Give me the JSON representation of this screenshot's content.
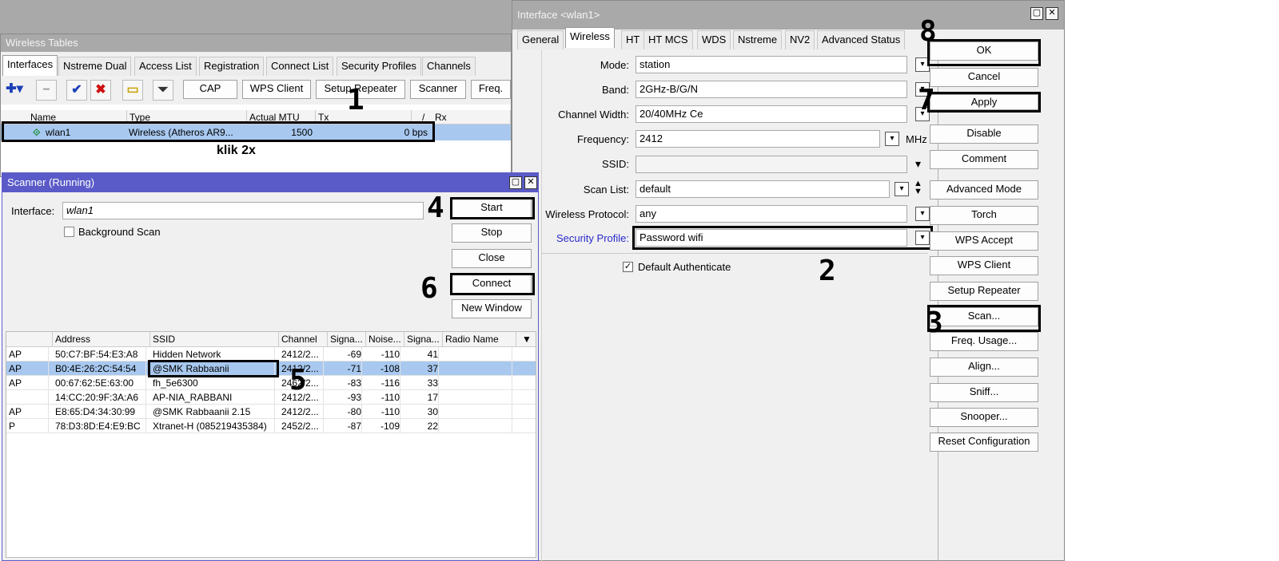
{
  "wireless_tables": {
    "title": "Wireless Tables",
    "tabs": [
      "Interfaces",
      "Nstreme Dual",
      "Access List",
      "Registration",
      "Connect List",
      "Security Profiles",
      "Channels"
    ],
    "toolbar": {
      "cap": "CAP",
      "wps_client": "WPS Client",
      "setup_repeater": "Setup Repeater",
      "scanner": "Scanner",
      "freq": "Freq."
    },
    "columns": [
      "Name",
      "Type",
      "Actual MTU",
      "Tx",
      "/",
      "Rx"
    ],
    "row": {
      "name": "wlan1",
      "type": "Wireless (Atheros AR9...",
      "mtu": "1500",
      "tx": "0 bps"
    },
    "note": "klik 2x"
  },
  "scanner": {
    "title": "Scanner (Running)",
    "interface_label": "Interface:",
    "interface_value": "wlan1",
    "background_scan": "Background Scan",
    "buttons": {
      "start": "Start",
      "stop": "Stop",
      "close": "Close",
      "connect": "Connect",
      "new_window": "New Window"
    },
    "columns": [
      "",
      "Address",
      "SSID",
      "Channel",
      "Signa...",
      "Noise...",
      "Signa...",
      "Radio Name"
    ],
    "rows": [
      [
        "AP",
        "50:C7:BF:54:E3:A8",
        "Hidden Network",
        "2412/2...",
        "-69",
        "-110",
        "41",
        ""
      ],
      [
        "AP",
        "B0:4E:26:2C:54:54",
        "@SMK Rabbaanii",
        "2412/2...",
        "-71",
        "-108",
        "37",
        ""
      ],
      [
        "AP",
        "00:67:62:5E:63:00",
        "fh_5e6300",
        "2462/2...",
        "-83",
        "-116",
        "33",
        ""
      ],
      [
        "",
        "14:CC:20:9F:3A:A6",
        "AP-NIA_RABBANI",
        "2412/2...",
        "-93",
        "-110",
        "17",
        ""
      ],
      [
        "AP",
        "E8:65:D4:34:30:99",
        "@SMK Rabbaanii 2.15",
        "2412/2...",
        "-80",
        "-110",
        "30",
        ""
      ],
      [
        "P",
        "78:D3:8D:E4:E9:BC",
        "Xtranet-H (085219435384)",
        "2452/2...",
        "-87",
        "-109",
        "22",
        ""
      ]
    ]
  },
  "interface": {
    "title": "Interface <wlan1>",
    "tabs": [
      "General",
      "Wireless",
      "HT",
      "HT MCS",
      "WDS",
      "Nstreme",
      "NV2",
      "Advanced Status"
    ],
    "fields": {
      "mode_label": "Mode:",
      "mode": "station",
      "band_label": "Band:",
      "band": "2GHz-B/G/N",
      "cw_label": "Channel Width:",
      "cw": "20/40MHz Ce",
      "freq_label": "Frequency:",
      "freq": "2412",
      "freq_unit": "MHz",
      "ssid_label": "SSID:",
      "ssid": "",
      "scanlist_label": "Scan List:",
      "scanlist": "default",
      "proto_label": "Wireless Protocol:",
      "proto": "any",
      "secprof_label": "Security Profile:",
      "secprof": "Password wifi",
      "default_auth": "Default Authenticate"
    },
    "buttons": [
      "OK",
      "Cancel",
      "Apply",
      "Disable",
      "Comment",
      "Advanced Mode",
      "Torch",
      "WPS Accept",
      "WPS Client",
      "Setup Repeater",
      "Scan...",
      "Freq. Usage...",
      "Align...",
      "Sniff...",
      "Snooper...",
      "Reset Configuration"
    ]
  },
  "annotations": [
    "1",
    "2",
    "3",
    "4",
    "5",
    "6",
    "7",
    "8"
  ],
  "colors": {
    "title_blue": "#5a5bc8",
    "selection": "#a8c8ef",
    "link_blue": "#2a2acc"
  }
}
